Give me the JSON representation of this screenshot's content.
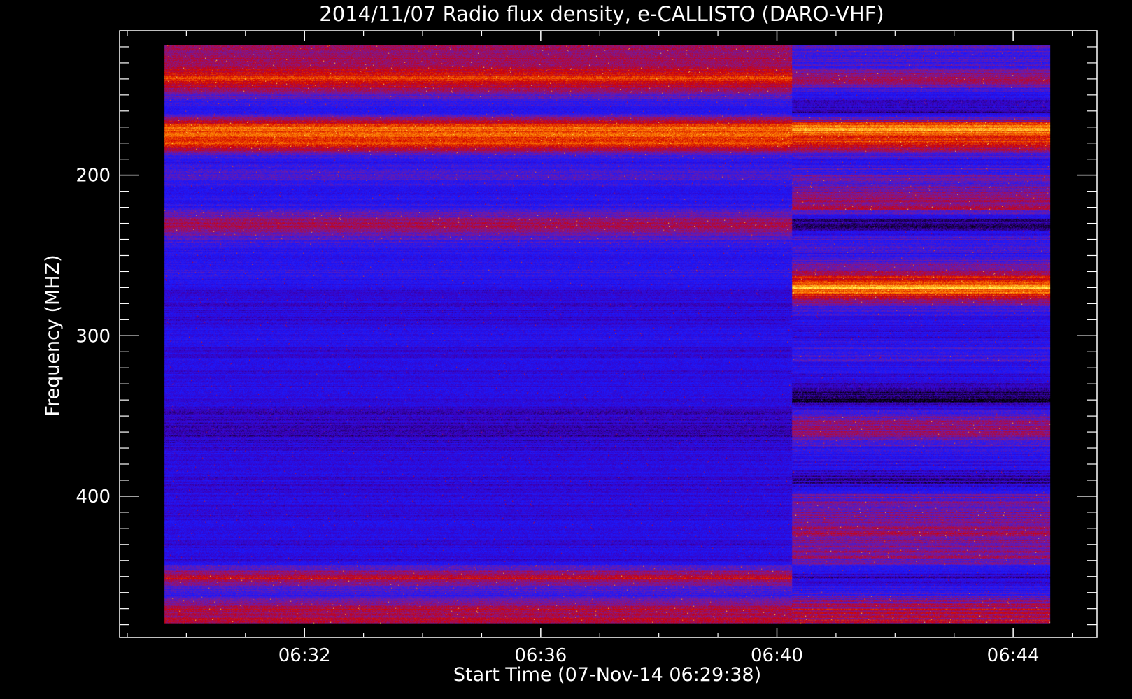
{
  "chart_data": {
    "type": "heatmap",
    "title": "2014/11/07  Radio flux density, e-CALLISTO (DARO-VHF)",
    "xlabel": "Start Time (07-Nov-14 06:29:38)",
    "ylabel": "Frequency (MHZ)",
    "x_start_minutes": 389.63,
    "x_end_minutes": 404.63,
    "xlim_minutes": [
      388.87,
      405.42
    ],
    "x_tick_values_minutes": [
      392,
      396,
      400,
      404
    ],
    "x_ticks": [
      "06:32",
      "06:36",
      "06:40",
      "06:44"
    ],
    "ylim": [
      110,
      488
    ],
    "y_ticks": [
      200,
      300,
      400
    ],
    "data_ylim": [
      119,
      479
    ],
    "change_at_minutes": 400.25,
    "freq_axis": [
      130,
      140,
      150,
      160,
      170,
      180,
      190,
      200,
      210,
      220,
      230,
      240,
      250,
      260,
      270,
      280,
      290,
      300,
      310,
      320,
      330,
      340,
      350,
      360,
      370,
      380,
      390,
      400,
      410,
      420,
      430,
      440,
      450,
      460,
      470
    ],
    "left_segment_levels": [
      0.55,
      0.75,
      0.45,
      0.3,
      0.8,
      0.75,
      0.3,
      0.45,
      0.28,
      0.35,
      0.6,
      0.4,
      0.28,
      0.35,
      0.25,
      0.25,
      0.25,
      0.3,
      0.25,
      0.25,
      0.28,
      0.25,
      0.2,
      0.15,
      0.25,
      0.25,
      0.25,
      0.25,
      0.25,
      0.25,
      0.25,
      0.25,
      0.65,
      0.35,
      0.6
    ],
    "right_segment_levels": [
      0.4,
      0.55,
      0.3,
      0.15,
      0.85,
      0.7,
      0.3,
      0.45,
      0.5,
      0.6,
      0.05,
      0.4,
      0.35,
      0.55,
      0.9,
      0.45,
      0.3,
      0.25,
      0.4,
      0.3,
      0.2,
      0.05,
      0.5,
      0.55,
      0.35,
      0.3,
      0.15,
      0.45,
      0.5,
      0.55,
      0.5,
      0.5,
      0.2,
      0.4,
      0.6
    ],
    "colorscale": [
      "#000000",
      "#3d00b8",
      "#1a1aff",
      "#7a1a9a",
      "#d00000",
      "#ff8000",
      "#ffff60"
    ]
  }
}
